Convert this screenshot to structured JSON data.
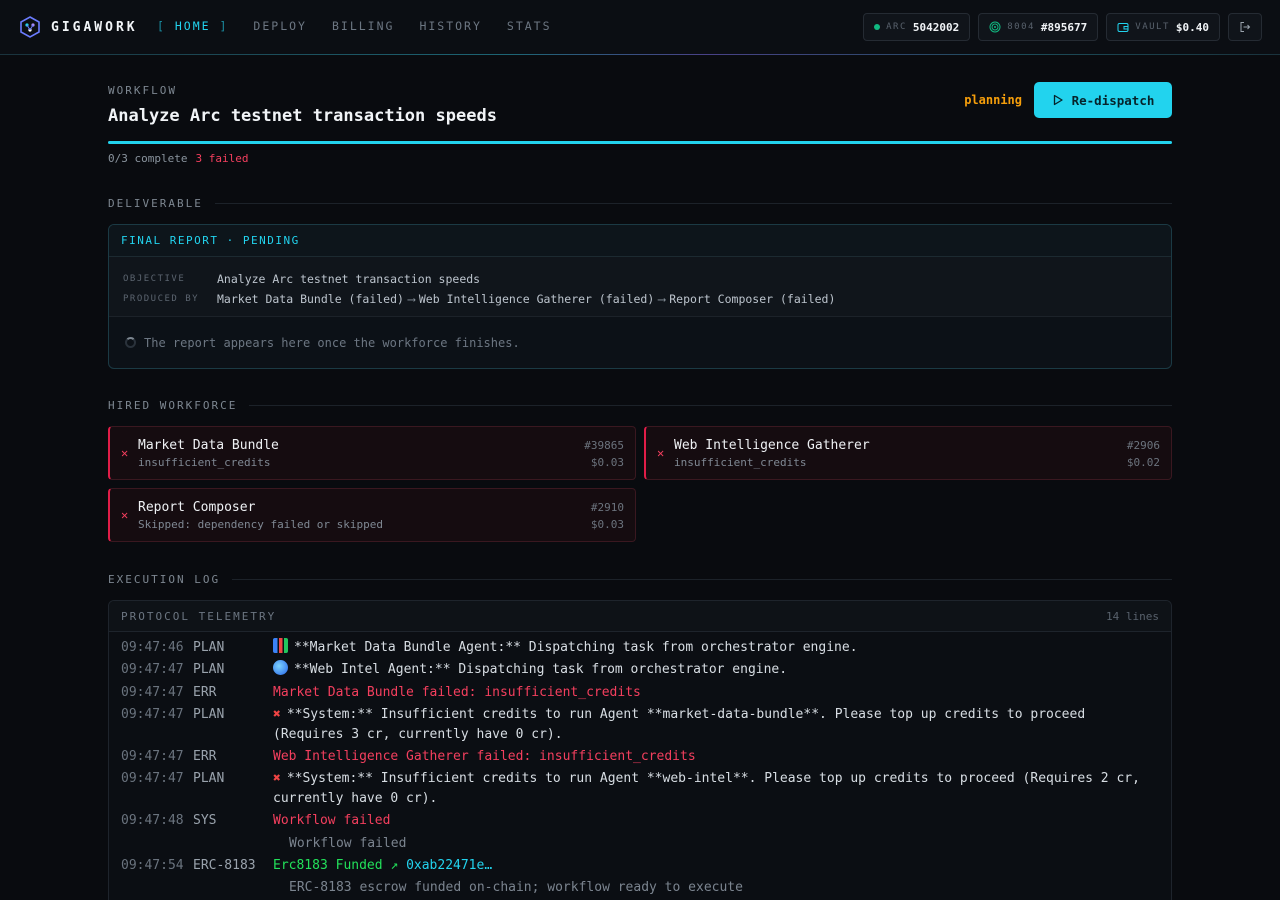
{
  "app": {
    "name": "GIGAWORK"
  },
  "nav": {
    "items": [
      {
        "label": "HOME",
        "active": true
      },
      {
        "label": "DEPLOY",
        "active": false
      },
      {
        "label": "BILLING",
        "active": false
      },
      {
        "label": "HISTORY",
        "active": false
      },
      {
        "label": "STATS",
        "active": false
      }
    ]
  },
  "chips": {
    "arc": {
      "label": "ARC",
      "value": "5042002"
    },
    "id8004": {
      "label": "8004",
      "value": "#895677"
    },
    "vault": {
      "label": "VAULT",
      "value": "$0.40"
    }
  },
  "workflow": {
    "eyebrow": "WORKFLOW",
    "title": "Analyze Arc testnet transaction speeds",
    "status": "planning",
    "redispatch_label": "Re-dispatch",
    "progress_text": "0/3 complete",
    "failed_text": "3 failed",
    "progress_fraction": 1.0
  },
  "deliverable": {
    "section_label": "DELIVERABLE",
    "header": "FINAL REPORT · PENDING",
    "objective_key": "OBJECTIVE",
    "objective_val": "Analyze Arc testnet transaction speeds",
    "produced_key": "PRODUCED BY",
    "produced_steps": [
      "Market Data Bundle (failed)",
      "Web Intelligence Gatherer (failed)",
      "Report Composer (failed)"
    ],
    "pending_text": "The report appears here once the workforce finishes."
  },
  "workforce": {
    "section_label": "HIRED WORKFORCE",
    "agents": [
      {
        "name": "Market Data Bundle",
        "reason": "insufficient_credits",
        "id": "#39865",
        "cost": "$0.03"
      },
      {
        "name": "Web Intelligence Gatherer",
        "reason": "insufficient_credits",
        "id": "#2906",
        "cost": "$0.02"
      },
      {
        "name": "Report Composer",
        "reason": "Skipped: dependency failed or skipped",
        "id": "#2910",
        "cost": "$0.03"
      }
    ]
  },
  "log": {
    "section_label": "EXECUTION LOG",
    "title": "PROTOCOL TELEMETRY",
    "count": "14 lines",
    "lines": [
      {
        "time": "09:47:46",
        "tag": "PLAN",
        "icon": "bar-chart-emoji",
        "msg": "**Market Data Bundle Agent:** Dispatching task from orchestrator engine."
      },
      {
        "time": "09:47:47",
        "tag": "PLAN",
        "icon": "globe-emoji",
        "msg": "**Web Intel Agent:** Dispatching task from orchestrator engine."
      },
      {
        "time": "09:47:47",
        "tag": "ERR",
        "msg": "Market Data Bundle failed: insufficient_credits"
      },
      {
        "time": "09:47:47",
        "tag": "PLAN",
        "icon": "cross-mark-emoji",
        "msg": "**System:** Insufficient credits to run Agent **market-data-bundle**. Please top up credits to proceed",
        "msg2": "(Requires 3 cr, currently have 0 cr)."
      },
      {
        "time": "09:47:47",
        "tag": "ERR",
        "msg": "Web Intelligence Gatherer failed: insufficient_credits"
      },
      {
        "time": "09:47:47",
        "tag": "PLAN",
        "icon": "cross-mark-emoji",
        "msg": "**System:** Insufficient credits to run Agent **web-intel**. Please top up credits to proceed (Requires 2 cr,",
        "msg2": "currently have 0 cr)."
      },
      {
        "time": "09:47:48",
        "tag": "SYS",
        "msg": "Workflow failed",
        "sub": "Workflow failed"
      },
      {
        "time": "09:47:54",
        "tag": "ERC-8183",
        "msg": "Erc8183 Funded ↗",
        "hash": "0xab22471e…",
        "sub": "ERC-8183 escrow funded on-chain; workflow ready to execute"
      }
    ]
  },
  "colors": {
    "accent": "#22d3ee",
    "error": "#f43f5e",
    "warning": "#f59e0b",
    "success": "#22e05a"
  }
}
